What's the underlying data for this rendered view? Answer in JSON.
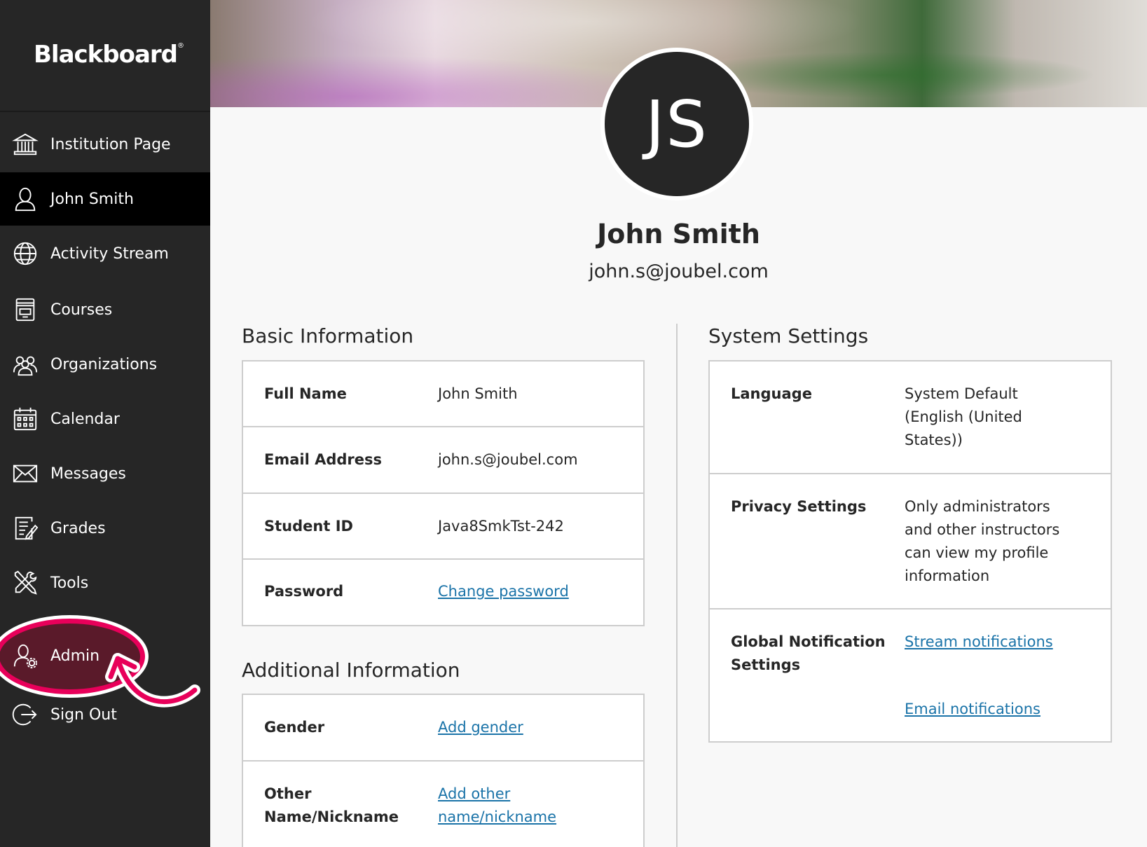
{
  "sidebar": {
    "logo": "Blackboard",
    "items": [
      {
        "label": "Institution Page",
        "icon": "institution-icon"
      },
      {
        "label": "John Smith",
        "icon": "user-icon",
        "active": true
      },
      {
        "label": "Activity Stream",
        "icon": "globe-icon"
      },
      {
        "label": "Courses",
        "icon": "courses-icon"
      },
      {
        "label": "Organizations",
        "icon": "organizations-icon"
      },
      {
        "label": "Calendar",
        "icon": "calendar-icon"
      },
      {
        "label": "Messages",
        "icon": "envelope-icon"
      },
      {
        "label": "Grades",
        "icon": "grades-icon"
      },
      {
        "label": "Tools",
        "icon": "tools-icon"
      },
      {
        "label": "Admin",
        "icon": "admin-icon"
      },
      {
        "label": "Sign Out",
        "icon": "sign-out-icon"
      }
    ]
  },
  "profile": {
    "initials": "JS",
    "name": "John Smith",
    "email": "john.s@joubel.com"
  },
  "basic_info": {
    "title": "Basic Information",
    "rows": [
      {
        "label": "Full Name",
        "value": "John Smith"
      },
      {
        "label": "Email Address",
        "value": "john.s@joubel.com"
      },
      {
        "label": "Student ID",
        "value": "Java8SmkTst-242"
      },
      {
        "label": "Password",
        "value": "Change password"
      }
    ]
  },
  "additional_info": {
    "title": "Additional Information",
    "rows": [
      {
        "label": "Gender",
        "value": "Add gender"
      },
      {
        "label_line1": "Other",
        "label_line2": "Name/Nickname",
        "value_line1": "Add other",
        "value_line2": "name/nickname"
      }
    ]
  },
  "system_settings": {
    "title": "System Settings",
    "rows": [
      {
        "label": "Language",
        "value_lines": [
          "System Default",
          "(English (United",
          "States))"
        ]
      },
      {
        "label": "Privacy Settings",
        "value_lines": [
          "Only administrators",
          "and other instructors",
          "can view my profile",
          "information"
        ]
      },
      {
        "label_line1": "Global Notification",
        "label_line2": "Settings",
        "link1": "Stream notifications",
        "link2": "Email notifications"
      }
    ]
  },
  "colors": {
    "sidebar_bg": "#262626",
    "active_bg": "#000000",
    "link": "#1a73a8",
    "highlight": "#e8005a"
  }
}
